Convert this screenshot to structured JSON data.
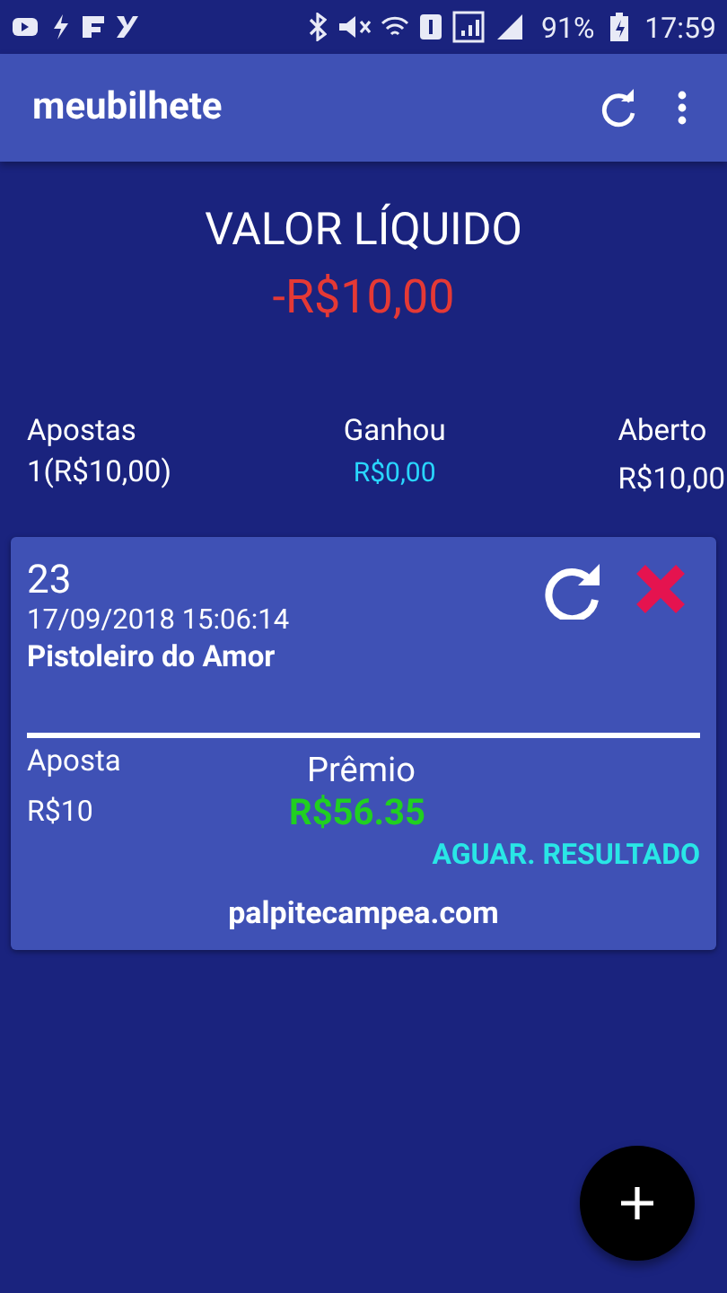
{
  "status_bar": {
    "battery": "91%",
    "time": "17:59"
  },
  "app_bar": {
    "title": "meubilhete"
  },
  "summary": {
    "title": "VALOR LÍQUIDO",
    "value": "-R$10,00",
    "stats": [
      {
        "label": "Apostas",
        "value": "1(R$10,00)",
        "kind": "plain"
      },
      {
        "label": "Ganhou",
        "value": "R$0,00",
        "kind": "highlight"
      },
      {
        "label": "Aberto",
        "value": "R$10,00",
        "kind": "plain"
      }
    ]
  },
  "tickets": [
    {
      "number": "23",
      "datetime": "17/09/2018 15:06:14",
      "name": "Pistoleiro do Amor",
      "bet_label": "Aposta",
      "bet": "R$10",
      "prize_label": "Prêmio",
      "prize": "R$56.35",
      "status": "AGUAR. RESULTADO",
      "site": "palpitecampea.com"
    }
  ]
}
